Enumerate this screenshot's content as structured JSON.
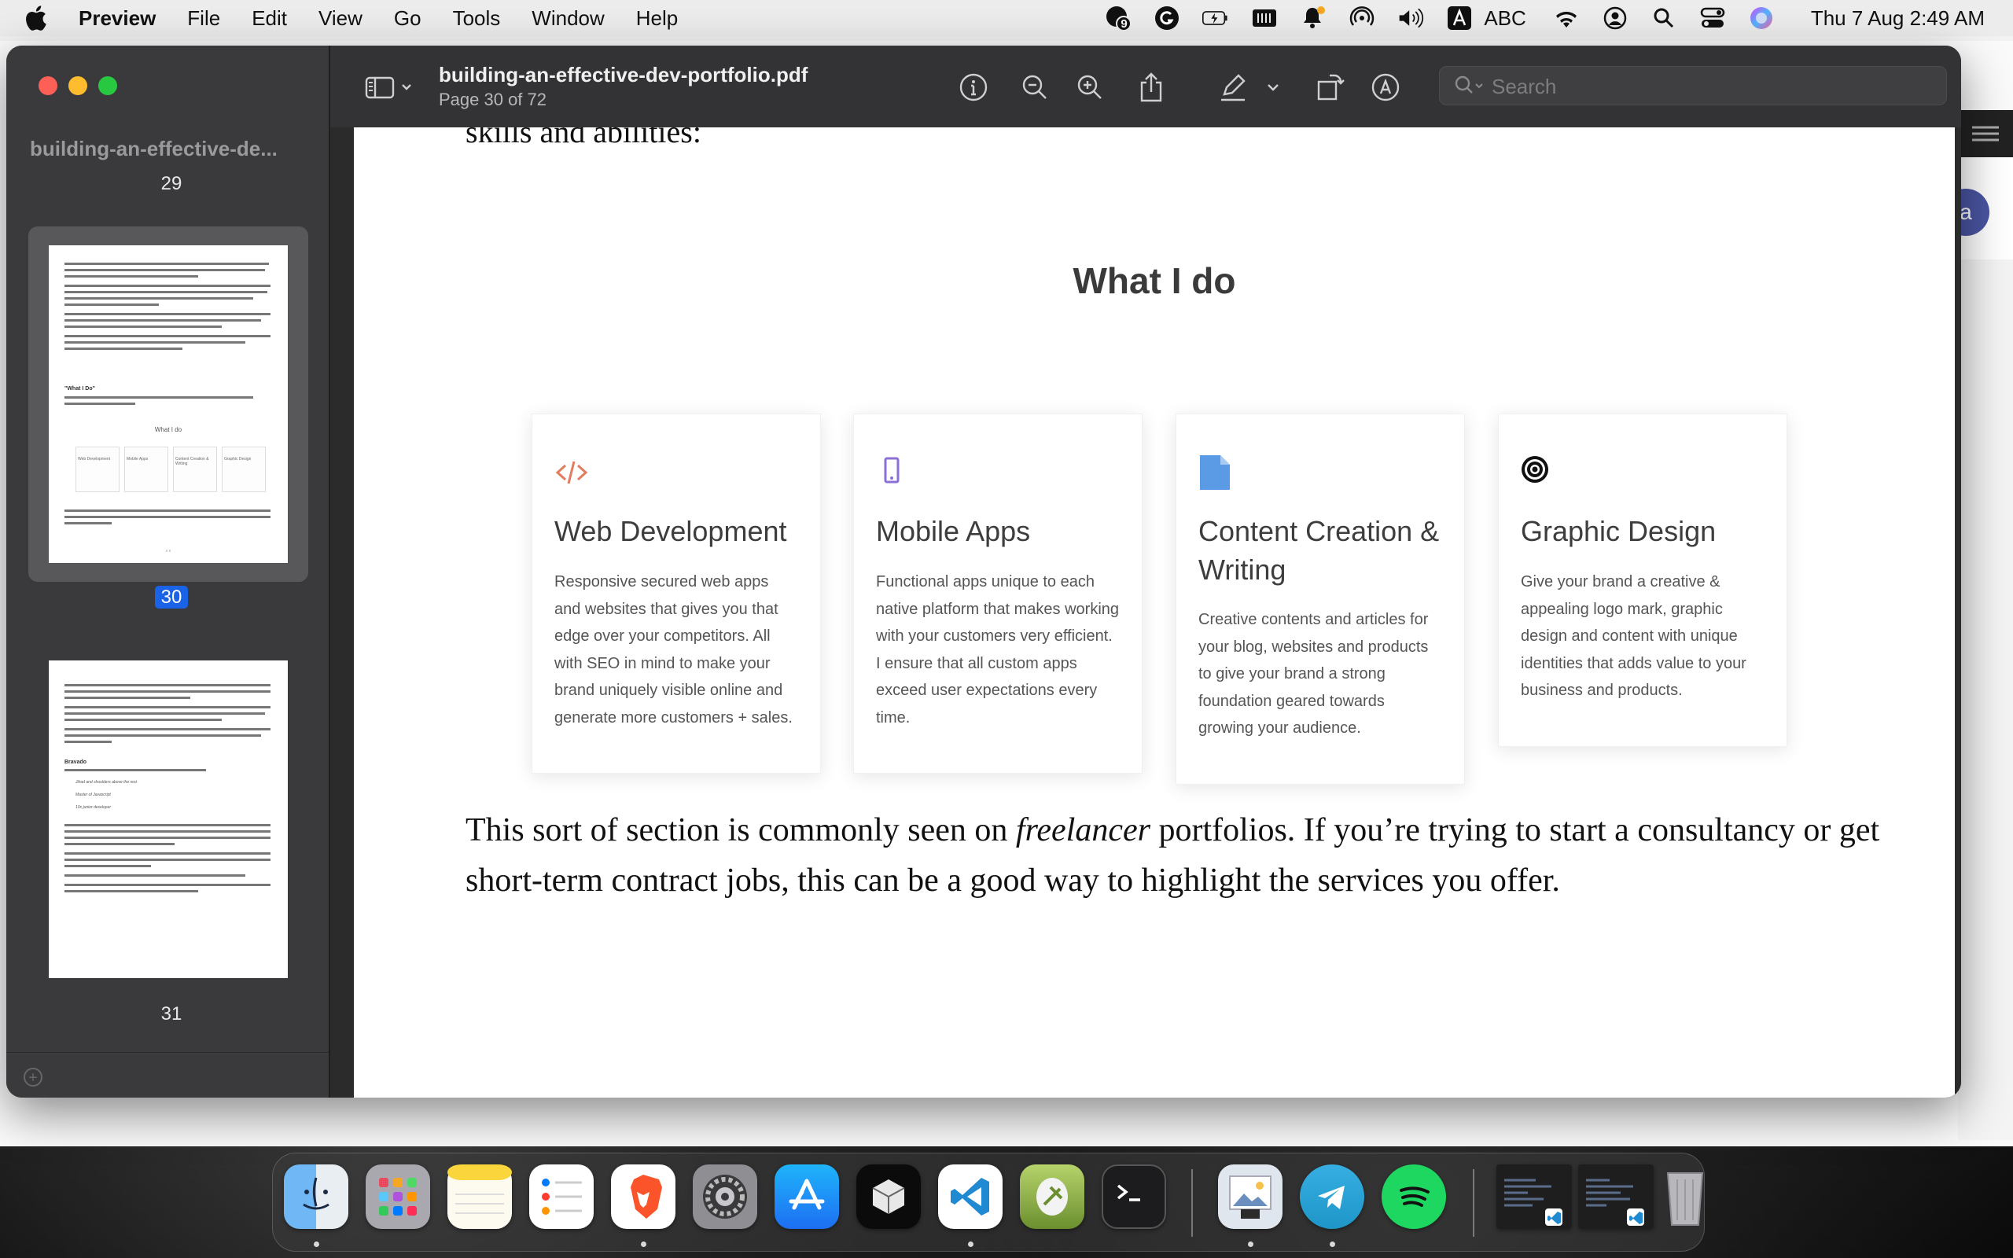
{
  "menubar": {
    "app_name": "Preview",
    "items": [
      "File",
      "Edit",
      "View",
      "Go",
      "Tools",
      "Window",
      "Help"
    ],
    "status": {
      "notification_count": "9",
      "input_source": "ABC",
      "clock": "Thu 7 Aug  2:49 AM"
    }
  },
  "sidebar": {
    "document_name": "building-an-effective-de...",
    "thumbnails": [
      {
        "page": "29"
      },
      {
        "page": "30",
        "selected": true
      },
      {
        "page": "31"
      }
    ],
    "thumb30": {
      "what_i_do_label": "\"What I Do\"",
      "mini_heading": "What I do",
      "mini_cards": [
        "Web Development",
        "Mobile Apps",
        "Content Creation & Writing",
        "Graphic Design"
      ],
      "folio": "x x"
    },
    "thumb31": {
      "subheading": "Bravado",
      "bullets": [
        "Jihad and shoulders above the rest",
        "Master of Javascript",
        "10x junior developer"
      ]
    }
  },
  "toolbar": {
    "title": "building-an-effective-dev-portfolio.pdf",
    "subtitle": "Page 30 of 72",
    "search_placeholder": "Search"
  },
  "page": {
    "intro_tail": "skills and abilities:",
    "section_heading": "What I do",
    "cards": [
      {
        "icon": "code-icon",
        "title": "Web Development",
        "body": "Responsive secured web apps and websites that gives you that edge over your competitors. All with SEO in mind to make your brand uniquely visible online and generate more customers + sales.",
        "accent": "#e27d60"
      },
      {
        "icon": "mobile-icon",
        "title": "Mobile Apps",
        "body": "Functional apps unique to each native platform that makes working with your customers very efficient. I ensure that all custom apps exceed user expectations every time.",
        "accent": "#8b6fd6"
      },
      {
        "icon": "document-icon",
        "title": "Content Creation & Writing",
        "body": "Creative contents and articles for your blog, websites and products to give your brand a strong foundation geared towards growing your audience.",
        "accent": "#5b9be6"
      },
      {
        "icon": "target-icon",
        "title": "Graphic Design",
        "body": "Give your brand a creative & appealing logo mark, graphic design and content with unique identities that adds value to your business and products.",
        "accent": "#111111"
      }
    ],
    "closing_before": "This sort of section is commonly seen on ",
    "closing_emphasis": "freelancer",
    "closing_after": " portfolios. If you’re trying to start a consultancy or get short-term contract jobs, this can be a good way to highlight the services you offer."
  },
  "dock": {
    "apps": [
      "Finder",
      "Launchpad",
      "Notes",
      "Reminders",
      "Brave",
      "System Settings",
      "App Store",
      "Parallels",
      "Visual Studio Code",
      "Rocket Typist",
      "Terminal",
      "Preview",
      "Telegram",
      "Spotify",
      "VS Code Window 1",
      "VS Code Window 2",
      "Trash"
    ]
  },
  "colors": {
    "menubar": "#ececec",
    "window_chrome": "#333336",
    "sidebar": "#3a3a3c",
    "selection": "#1a62e6"
  }
}
